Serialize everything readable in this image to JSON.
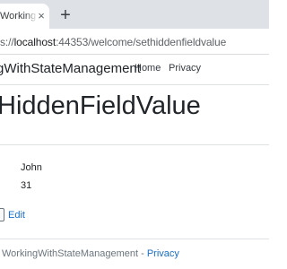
{
  "browser": {
    "tab_title": "WorkingW",
    "tab_close": "×",
    "new_tab": "+",
    "url_prefix": "s://",
    "url_host": "localhost",
    "url_rest": ":44353/welcome/sethiddenfieldvalue"
  },
  "navbar": {
    "brand": "gWithStateManagement",
    "links": [
      "Home",
      "Privacy"
    ]
  },
  "main": {
    "title": "HiddenFieldValue",
    "values": [
      "John",
      "31"
    ],
    "edit_label": "Edit"
  },
  "footer": {
    "prefix": "WorkingWithStateManagement - ",
    "link": "Privacy"
  },
  "colors": {
    "link": "#1b6ec2",
    "tabstrip": "#dee1e6"
  }
}
